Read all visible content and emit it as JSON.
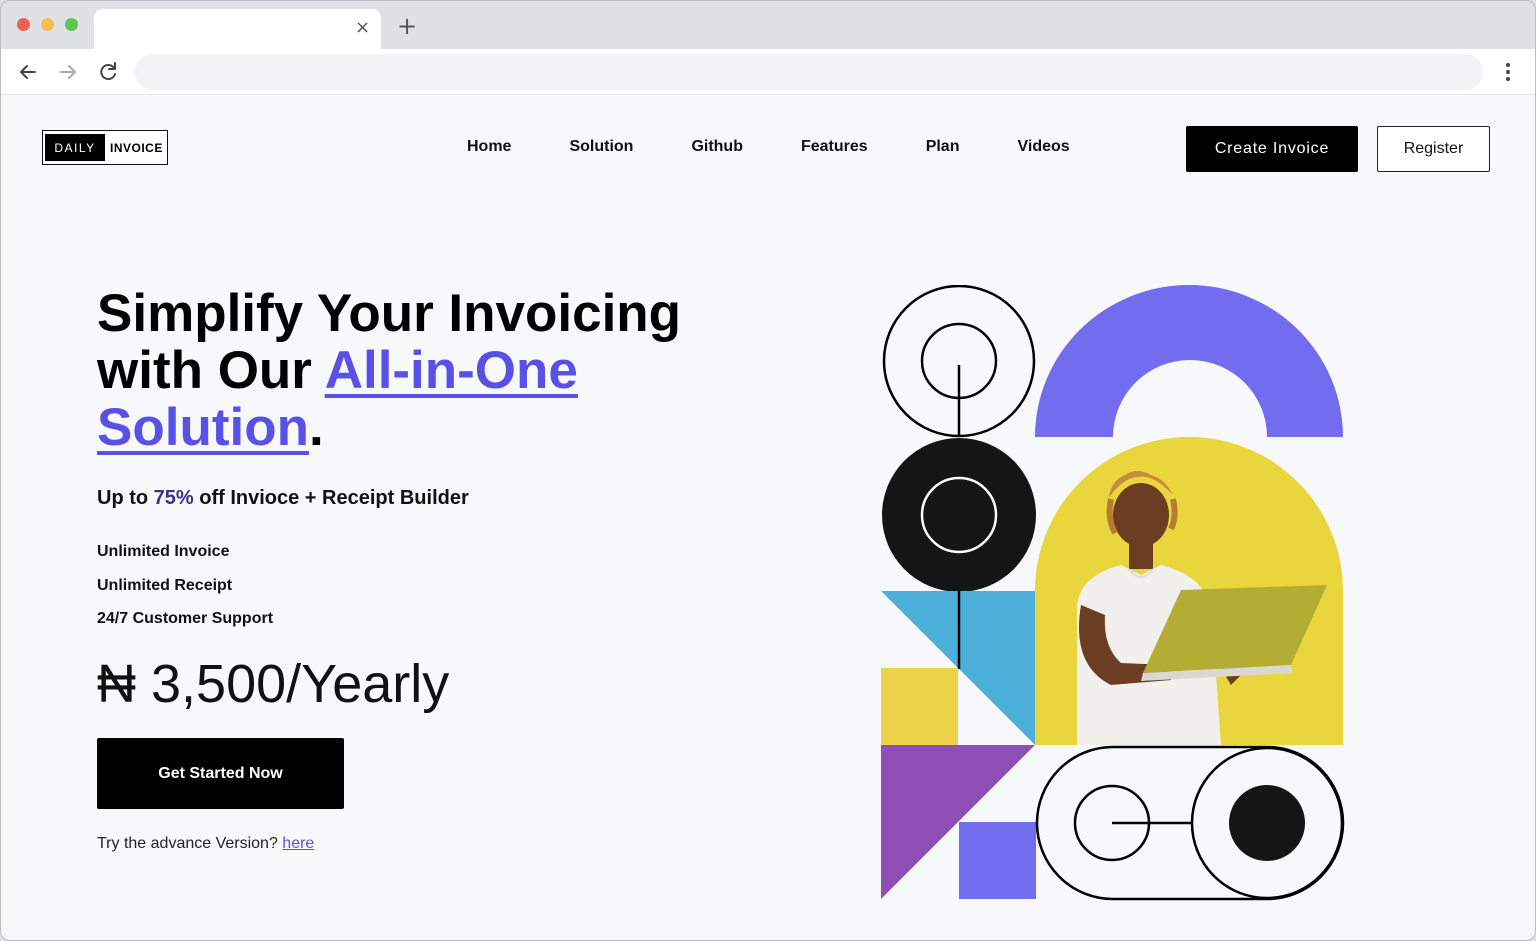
{
  "browser": {
    "tab_title": "",
    "tab_close_glyph": "×",
    "new_tab_glyph": "+",
    "address": ""
  },
  "header": {
    "logo_part1": "DAILY",
    "logo_part2": "INVOICE",
    "nav": [
      "Home",
      "Solution",
      "Github",
      "Features",
      "Plan",
      "Videos"
    ],
    "create_label": "Create Invoice",
    "register_label": "Register"
  },
  "hero": {
    "title_line1": "Simplify Your Invoicing",
    "title_line2_prefix": "with Our ",
    "title_highlight1": "All-in-One",
    "title_highlight2": "Solution",
    "title_suffix": ".",
    "offer_prefix": "Up to ",
    "offer_pct": "75%",
    "offer_suffix": " off Invioce + Receipt Builder",
    "features": [
      "Unlimited Invoice",
      "Unlimited Receipt",
      "24/7 Customer Support"
    ],
    "price": "₦ 3,500/Yearly",
    "cta": "Get Started Now",
    "advance_text": "Try the advance Version? ",
    "advance_link": "here"
  },
  "colors": {
    "accent": "#5b50e6",
    "violet": "#736cef",
    "yellow": "#ecd34a",
    "blue": "#4cb0db",
    "purple": "#8f4fb4",
    "black": "#000000"
  }
}
